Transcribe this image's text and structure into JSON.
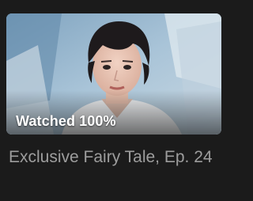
{
  "video_card": {
    "thumbnail_icon": "person-portrait-thumbnail",
    "watched_label": "Watched 100%",
    "watched_progress": 1.0,
    "title": "Exclusive Fairy Tale, Ep. 24"
  },
  "colors": {
    "background": "#1b1b1b",
    "title_text": "#9d9d9d",
    "badge_text": "#ffffff"
  }
}
